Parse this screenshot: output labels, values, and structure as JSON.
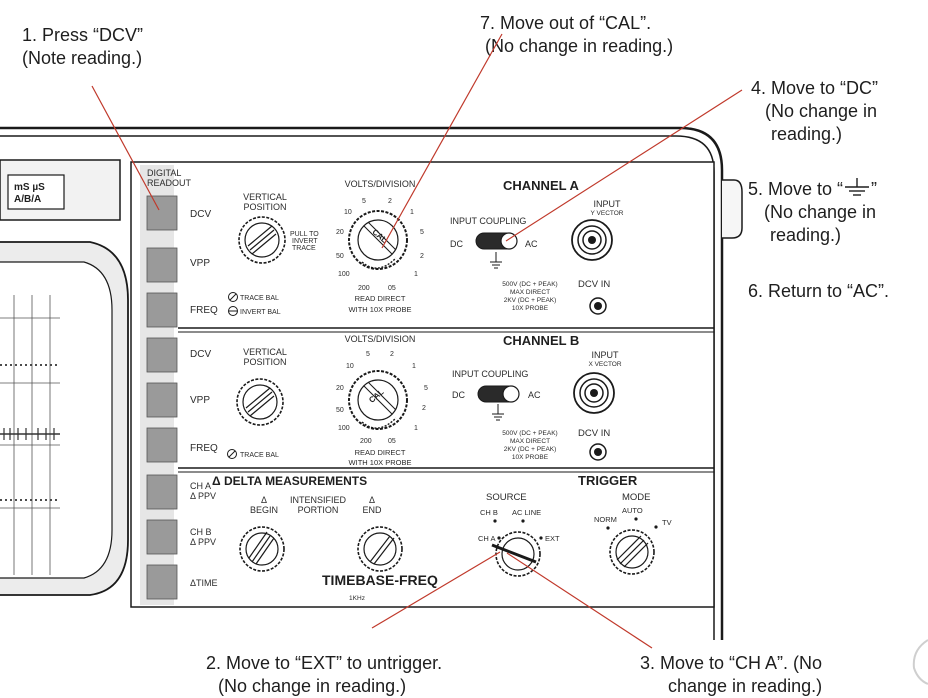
{
  "annotations": {
    "a1": {
      "l1": "1. Press “DCV”",
      "l2": "(Note reading.)"
    },
    "a7": {
      "l1": "7. Move out of “CAL”.",
      "l2": "(No change in reading.)"
    },
    "a4": {
      "l1": "4. Move to “DC”",
      "l2": "(No change in",
      "l3": "reading.)"
    },
    "a5": {
      "l1a": "5. Move to  “",
      "l1b": "”",
      "l2": "(No change in",
      "l3": "reading.)"
    },
    "a6": {
      "l1": "6. Return to “AC”."
    },
    "a2": {
      "l1": "2. Move to “EXT” to untrigger.",
      "l2": "(No change in reading.)"
    },
    "a3": {
      "l1": "3. Move to “CH A”. (No",
      "l2": "change in reading.)"
    }
  },
  "panel": {
    "display_units": {
      "l1": "mS µS",
      "l2": "A/B/A"
    },
    "digital_readout": {
      "l1": "DIGITAL",
      "l2": "READOUT"
    },
    "buttons": [
      "DCV",
      "VPP",
      "FREQ",
      "DCV",
      "VPP",
      "FREQ"
    ],
    "delta_buttons": [
      {
        "l1": "CH A",
        "l2": "Δ PPV"
      },
      {
        "l1": "CH B",
        "l2": "Δ PPV"
      },
      {
        "l1": "",
        "l2": "ΔTIME"
      }
    ],
    "channel_a": {
      "title": "CHANNEL A",
      "vertical_position": {
        "l1": "VERTICAL",
        "l2": "POSITION"
      },
      "pull_to": {
        "l1": "PULL TO",
        "l2": "INVERT",
        "l3": "TRACE"
      },
      "trace_bal": "TRACE BAL",
      "invert_bal": "INVERT BAL",
      "volts_division": "VOLTS/DIVISION",
      "knob_marks": {
        "m5": "5",
        "m2": "2",
        "m10": "10",
        "m1": "1",
        "m20": "20",
        "m5b": "5",
        "m50": "50",
        "m2b": "2",
        "m100": "100",
        "m1b": "1",
        "m200": "200",
        "m05": "05"
      },
      "cal": "CAL",
      "read_direct": {
        "l1": "READ DIRECT",
        "l2": "WITH 10X PROBE"
      },
      "input_coupling": "INPUT COUPLING",
      "dc": "DC",
      "ac": "AC",
      "input": {
        "l1": "INPUT",
        "l2": "Y VECTOR"
      },
      "max": {
        "l1": "500V (DC + PEAK)",
        "l2": "MAX DIRECT",
        "l3": "2KV (DC + PEAK)",
        "l4": "10X PROBE"
      },
      "dcv_in": "DCV IN"
    },
    "channel_b": {
      "title": "CHANNEL B",
      "vertical_position": {
        "l1": "VERTICAL",
        "l2": "POSITION"
      },
      "trace_bal": "TRACE BAL",
      "volts_division": "VOLTS/DIVISION",
      "knob_marks": {
        "m5": "5",
        "m2": "2",
        "m10": "10",
        "m1": "1",
        "m20": "20",
        "m5b": "5",
        "m50": "50",
        "m2b": "2",
        "m100": "100",
        "m1b": "1",
        "m200": "200",
        "m05": "05"
      },
      "cal": "CAL",
      "read_direct": {
        "l1": "READ DIRECT",
        "l2": "WITH 10X PROBE"
      },
      "input_coupling": "INPUT COUPLING",
      "dc": "DC",
      "ac": "AC",
      "input": {
        "l1": "INPUT",
        "l2": "X VECTOR"
      },
      "max": {
        "l1": "500V (DC + PEAK)",
        "l2": "MAX DIRECT",
        "l3": "2KV (DC + PEAK)",
        "l4": "10X PROBE"
      },
      "dcv_in": "DCV IN"
    },
    "delta": {
      "title": "Δ DELTA MEASUREMENTS",
      "begin": {
        "l1": "Δ",
        "l2": "BEGIN"
      },
      "intensified": {
        "l1": "INTENSIFIED",
        "l2": "PORTION"
      },
      "end": {
        "l1": "Δ",
        "l2": "END"
      },
      "timebase": "TIMEBASE-FREQ",
      "khz": "1KHz"
    },
    "trigger": {
      "title": "TRIGGER",
      "source": "SOURCE",
      "mode": "MODE",
      "chb": "CH B",
      "acline": "AC LINE",
      "cha": "CH A",
      "ext": "EXT",
      "norm": "NORM",
      "auto": "AUTO",
      "tv": "TV"
    }
  }
}
